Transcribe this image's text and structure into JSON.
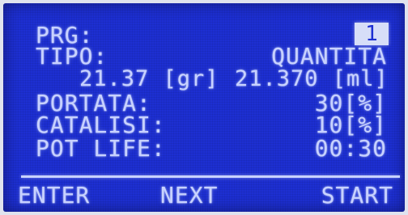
{
  "screen": {
    "prg_label": "PRG:",
    "prg_value": "1",
    "tipo_label": "TIPO:",
    "tipo_value": "QUANTITA",
    "weight": "21.37 [gr]",
    "volume": "21.370 [ml]",
    "portata_label": "PORTATA:",
    "portata_value": "30[%]",
    "catalisi_label": "CATALISI:",
    "catalisi_value": "10[%]",
    "potlife_label": "POT LIFE:",
    "potlife_value": "00:30"
  },
  "softkeys": {
    "enter": "ENTER",
    "next": "NEXT",
    "start": "START"
  },
  "colors": {
    "background": "#1d2fd2",
    "text": "#c8d2ff"
  }
}
